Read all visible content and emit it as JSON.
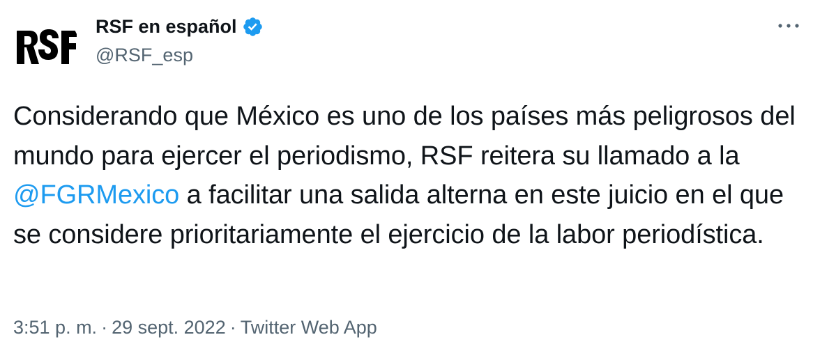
{
  "author": {
    "display_name": "RSF en español",
    "handle": "@RSF_esp",
    "avatar_logo_text": "RSF",
    "verified": true
  },
  "tweet": {
    "text_before_mention": "Considerando que México es uno de los países más peligrosos del mundo para ejercer el periodismo, RSF reitera su llamado a la ",
    "mention": "@FGRMexico",
    "text_after_mention": " a facilitar una salida alterna en este juicio en el que se considere prioritariamente el ejercicio de la labor periodística."
  },
  "meta": {
    "time": "3:51 p. m.",
    "separator": "·",
    "date": "29 sept. 2022",
    "source": "Twitter Web App"
  },
  "icons": {
    "verified": "verified-badge-icon",
    "more": "more-options-icon"
  },
  "colors": {
    "text": "#0f1419",
    "secondary": "#536471",
    "link": "#1d9bf0",
    "verified": "#1d9bf0"
  }
}
